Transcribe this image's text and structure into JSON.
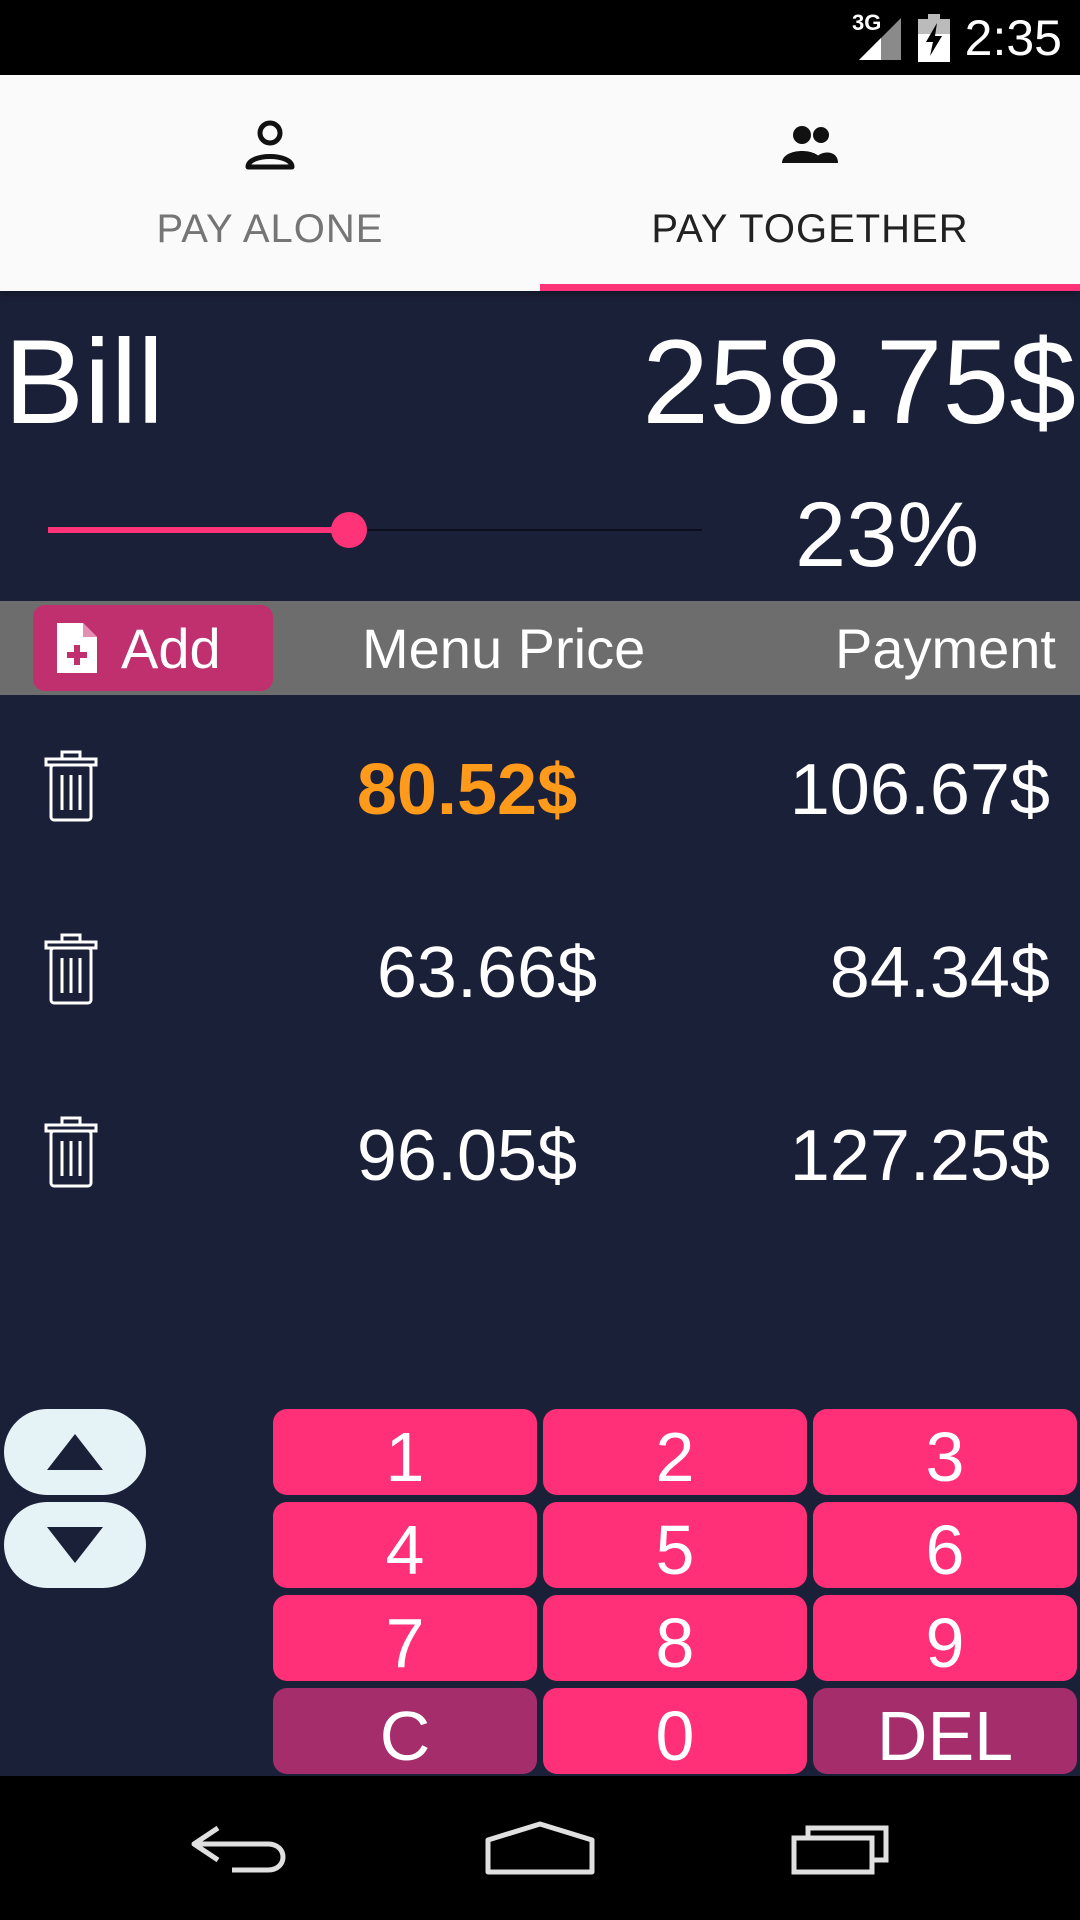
{
  "status_bar": {
    "network": "3G",
    "time": "2:35",
    "icons": [
      "signal-icon",
      "battery-charging-icon"
    ]
  },
  "tabs": [
    {
      "label": "PAY ALONE",
      "icon": "person-icon",
      "selected": false
    },
    {
      "label": "PAY TOGETHER",
      "icon": "group-icon",
      "selected": true
    }
  ],
  "bill": {
    "label": "Bill",
    "total": "258.75$"
  },
  "tip": {
    "percent_label": "23%",
    "slider_fraction": 0.46
  },
  "list_header": {
    "add_label": "Add",
    "menu_price_label": "Menu Price",
    "payment_label": "Payment"
  },
  "rows": [
    {
      "menu_price": "80.52$",
      "payment": "106.67$",
      "selected": true
    },
    {
      "menu_price": "63.66$",
      "payment": "84.34$",
      "selected": false
    },
    {
      "menu_price": "96.05$",
      "payment": "127.25$",
      "selected": false
    }
  ],
  "keypad": {
    "keys": [
      "1",
      "2",
      "3",
      "4",
      "5",
      "6",
      "7",
      "8",
      "9",
      "C",
      "0",
      "DEL"
    ]
  },
  "colors": {
    "accent": "#ff3377",
    "key": "#ff2f78",
    "key_alt": "#a52d6b",
    "background": "#1b2039",
    "selected_price": "#ff9a1a",
    "header_bar": "#6d6d6d"
  },
  "nav_bar": {
    "icons": [
      "back-icon",
      "home-icon",
      "recents-icon"
    ]
  }
}
